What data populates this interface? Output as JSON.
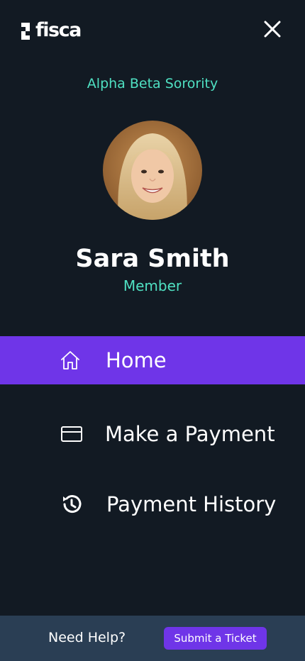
{
  "header": {
    "logo_text": "fisca",
    "close_icon": "close-icon"
  },
  "profile": {
    "organization": "Alpha Beta Sorority",
    "name": "Sara Smith",
    "role": "Member"
  },
  "nav": {
    "items": [
      {
        "label": "Home",
        "icon": "home-icon",
        "active": true
      },
      {
        "label": "Make a Payment",
        "icon": "credit-card-icon",
        "active": false
      },
      {
        "label": "Payment History",
        "icon": "history-icon",
        "active": false
      }
    ]
  },
  "footer": {
    "help_label": "Need Help?",
    "ticket_button": "Submit a Ticket"
  },
  "colors": {
    "background": "#121a23",
    "accent": "#6f35e8",
    "teal": "#4fe0c2",
    "footer": "#2a3e54"
  }
}
